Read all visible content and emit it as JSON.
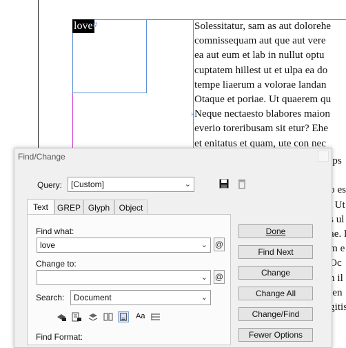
{
  "document": {
    "selected_word": "love",
    "hash_marker": "#",
    "text_marker": "»",
    "body_lines": [
      "Solessitatur, sam as aut dolorehe",
      "comnissequam aut que aut vere",
      "ea aut eum et lab in nullut optu",
      "cuptatem hillest ut et ulpa ea do",
      "tempe liaerum a volorae landan",
      "Otaque et poriae. Ut quaerem qu",
      "Neque nectaesto blabores maion",
      "everio toreribusam sit etur? Ehe",
      "et enitatus et quam, ute con nec"
    ],
    "right_fragments": [
      "ips",
      "",
      "o es",
      ". Ut",
      "s ul",
      "ae. l",
      "m e",
      "Oc",
      "n il",
      "len",
      "gitis"
    ]
  },
  "dialog": {
    "title": "Find/Change",
    "query_label": "Query:",
    "query_value": "[Custom]",
    "tabs": [
      "Text",
      "GREP",
      "Glyph",
      "Object"
    ],
    "active_tab": "Text",
    "find_what_label": "Find what:",
    "find_what_value": "love",
    "change_to_label": "Change to:",
    "change_to_value": "",
    "search_label": "Search:",
    "search_value": "Document",
    "find_format_label": "Find Format:",
    "at_symbol": "@",
    "buttons": {
      "done": "Done",
      "find_next": "Find Next",
      "change": "Change",
      "change_all": "Change All",
      "change_find": "Change/Find",
      "fewer_options": "Fewer Options"
    },
    "options_aa": "Aa"
  }
}
